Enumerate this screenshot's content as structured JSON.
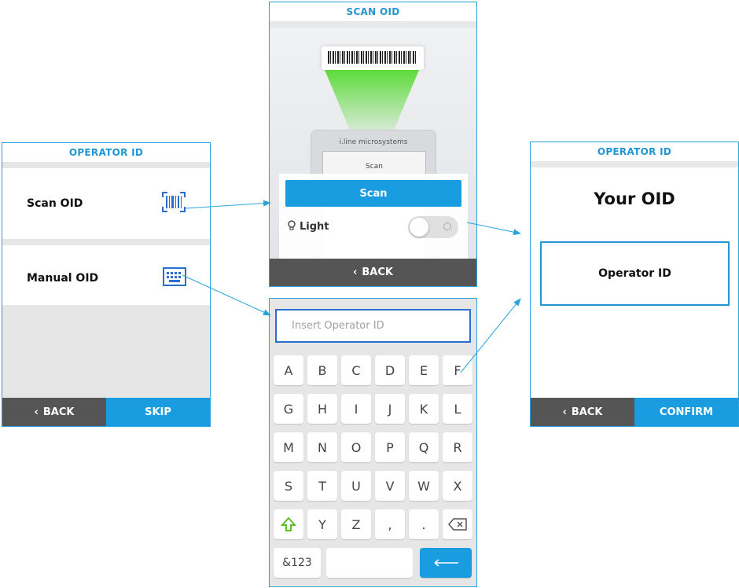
{
  "screen1": {
    "title": "OPERATOR ID",
    "items": [
      {
        "label": "Scan OID",
        "icon": "barcode-scan-icon"
      },
      {
        "label": "Manual OID",
        "icon": "keyboard-icon"
      }
    ],
    "back_label": "BACK",
    "skip_label": "SKIP"
  },
  "screen2": {
    "title": "SCAN OID",
    "device_brand": "i.line microsystems",
    "device_screen_label": "Scan",
    "scan_button": "Scan",
    "light_label": "Light",
    "light_on": false,
    "back_label": "BACK"
  },
  "screen3": {
    "input_placeholder": "Insert Operator ID",
    "rows": [
      [
        "A",
        "B",
        "C",
        "D",
        "E",
        "F"
      ],
      [
        "G",
        "H",
        "I",
        "J",
        "K",
        "L"
      ],
      [
        "M",
        "N",
        "O",
        "P",
        "Q",
        "R"
      ],
      [
        "S",
        "T",
        "U",
        "V",
        "W",
        "X"
      ],
      [
        "shift",
        "Y",
        "Z",
        ",",
        ".",
        "backspace"
      ]
    ],
    "symbols_label": "&123"
  },
  "screen4": {
    "title": "OPERATOR ID",
    "heading": "Your OID",
    "value_label": "Operator ID",
    "back_label": "BACK",
    "confirm_label": "CONFIRM"
  },
  "colors": {
    "accent": "#1a9de0",
    "title": "#2196d3",
    "dark_footer": "#555555",
    "shift_green": "#5cbf2a",
    "input_border": "#2a6fcf"
  }
}
